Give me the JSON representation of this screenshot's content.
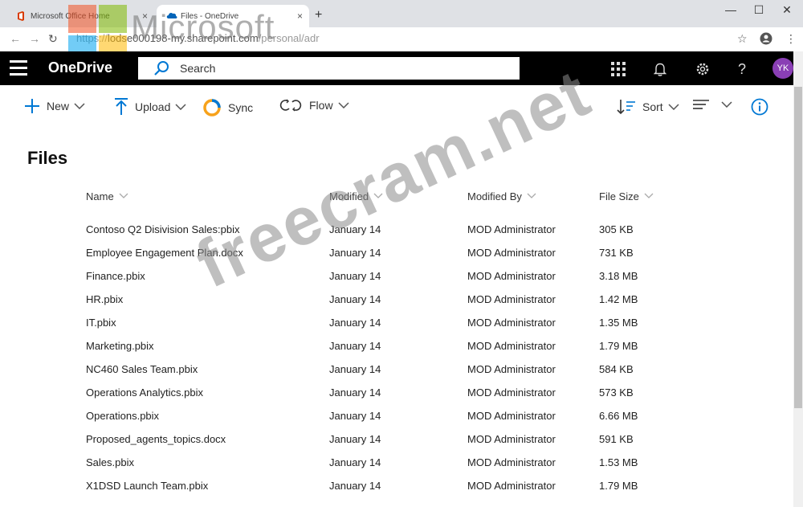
{
  "browser": {
    "tabs": [
      {
        "title": "Microsoft Office Home",
        "close": "×"
      },
      {
        "title": "Files - OneDrive",
        "close": "×"
      }
    ],
    "new_tab": "+",
    "window_controls": [
      "—",
      "☐",
      "✕"
    ],
    "url_prefix": "https://",
    "url_host": "lodse000198-my.sharepoint.com",
    "url_path": "/personal/adr"
  },
  "watermark": {
    "logo_text": "Microsoft",
    "site": "freecram.net",
    "colors": [
      "#f25022",
      "#7fba00",
      "#00a4ef",
      "#ffb900"
    ]
  },
  "suitebar": {
    "app_name": "OneDrive",
    "search_placeholder": "Search",
    "avatar_initials": "YK",
    "icons": [
      "app-launcher-icon",
      "bell-icon",
      "gear-icon",
      "help-icon"
    ]
  },
  "commands": {
    "new": "New",
    "upload": "Upload",
    "sync": "Sync",
    "flow": "Flow",
    "sort": "Sort"
  },
  "page": {
    "title": "Files"
  },
  "list": {
    "columns": [
      "Name",
      "Modified",
      "Modified By",
      "File Size"
    ],
    "rows": [
      {
        "name": "Contoso Q2 Disivision Sales:pbix",
        "modified": "January 14",
        "by": "MOD Administrator",
        "size": "305 KB"
      },
      {
        "name": "Employee Engagement Plan.docx",
        "modified": "January 14",
        "by": "MOD Administrator",
        "size": "731 KB"
      },
      {
        "name": "Finance.pbix",
        "modified": "January 14",
        "by": "MOD Administrator",
        "size": "3.18 MB"
      },
      {
        "name": "HR.pbix",
        "modified": "January 14",
        "by": "MOD Administrator",
        "size": "1.42 MB"
      },
      {
        "name": "IT.pbix",
        "modified": "January 14",
        "by": "MOD Administrator",
        "size": "1.35 MB"
      },
      {
        "name": "Marketing.pbix",
        "modified": "January 14",
        "by": "MOD Administrator",
        "size": "1.79 MB"
      },
      {
        "name": "NC460 Sales Team.pbix",
        "modified": "January 14",
        "by": "MOD Administrator",
        "size": "584 KB"
      },
      {
        "name": "Operations Analytics.pbix",
        "modified": "January 14",
        "by": "MOD Administrator",
        "size": "573 KB"
      },
      {
        "name": "Operations.pbix",
        "modified": "January 14",
        "by": "MOD Administrator",
        "size": "6.66 MB"
      },
      {
        "name": "Proposed_agents_topics.docx",
        "modified": "January 14",
        "by": "MOD Administrator",
        "size": "591 KB"
      },
      {
        "name": "Sales.pbix",
        "modified": "January 14",
        "by": "MOD Administrator",
        "size": "1.53 MB"
      },
      {
        "name": "X1DSD Launch Team.pbix",
        "modified": "January 14",
        "by": "MOD Administrator",
        "size": "1.79 MB"
      }
    ]
  }
}
